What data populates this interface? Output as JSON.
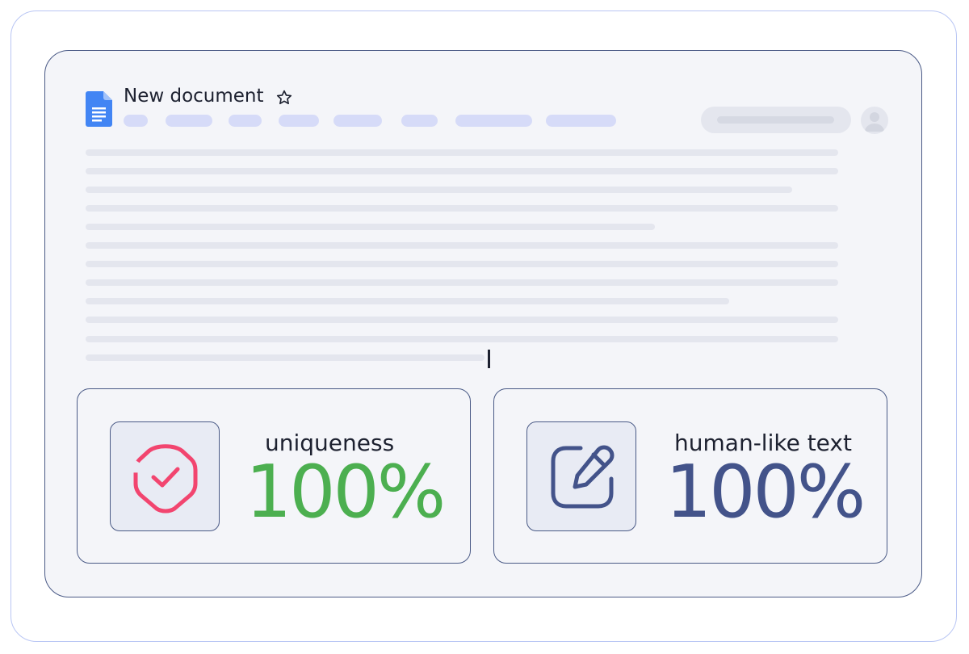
{
  "document": {
    "title": "New document"
  },
  "icons": {
    "docs": "google-docs-icon",
    "star": "star-outline-icon",
    "avatar": "user-avatar-icon",
    "shield": "shield-check-icon",
    "edit": "edit-pencil-icon"
  },
  "colors": {
    "docs_blue": "#4285f4",
    "menu_pill": "#d6dbf8",
    "text_placeholder": "#e4e6ee",
    "uniqueness_green": "#4caf50",
    "shield_pink": "#f2456f",
    "humanlike_navy": "#43538a",
    "card_border": "#4a5a86"
  },
  "stats": [
    {
      "label": "uniqueness",
      "value": "100%"
    },
    {
      "label": "human-like text",
      "value": "100%"
    }
  ]
}
